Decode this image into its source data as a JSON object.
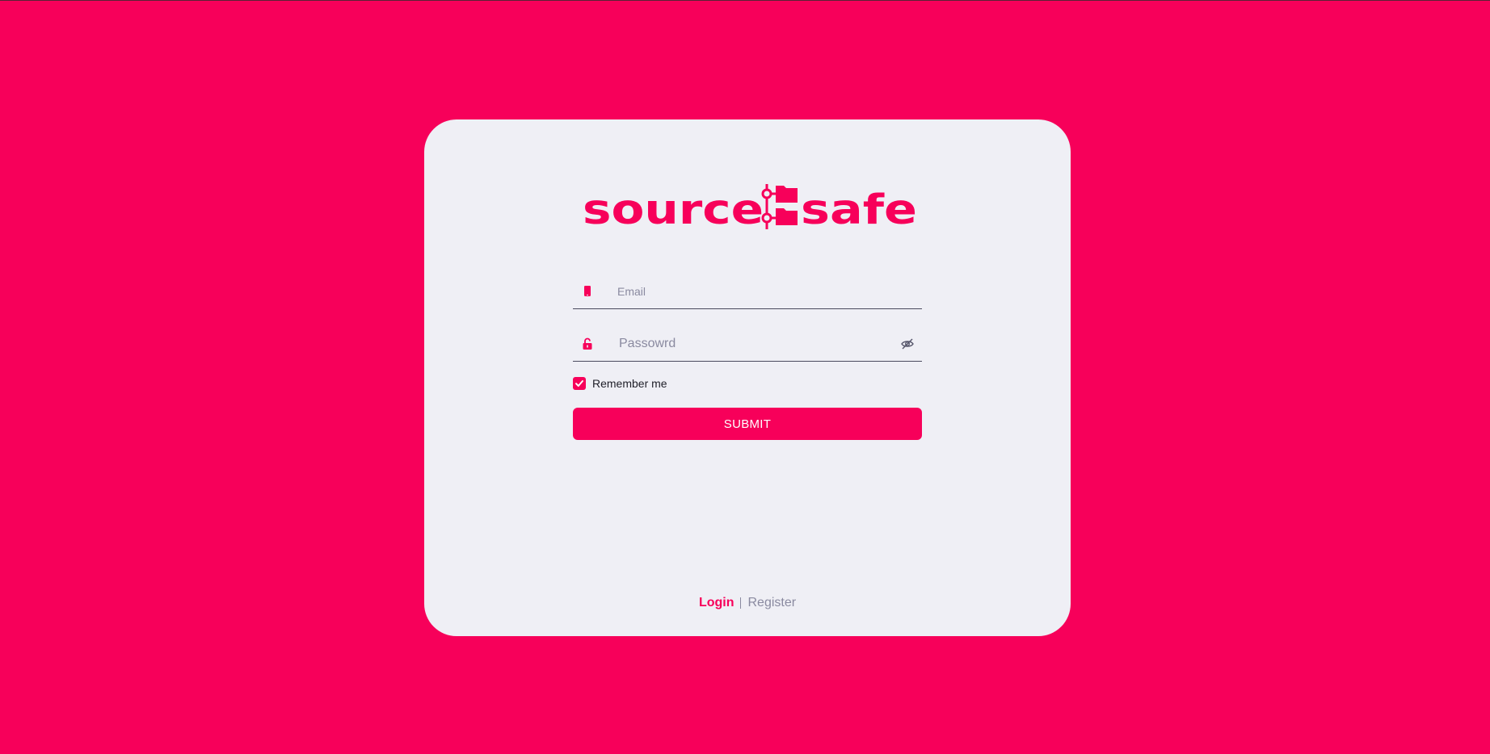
{
  "theme": {
    "accent": "#f7005a",
    "card_background": "#efeff5",
    "muted_text": "#8a8aa0"
  },
  "logo": {
    "text_left": "source",
    "text_right": "safe",
    "icon": "folder-tree-icon"
  },
  "form": {
    "email": {
      "placeholder": "Email",
      "value": "",
      "icon": "phone-icon"
    },
    "password": {
      "placeholder": "Passowrd",
      "value": "",
      "icon": "unlock-icon",
      "toggle_icon": "eye-off-icon"
    },
    "remember": {
      "label": "Remember me",
      "checked": true
    },
    "submit_label": "SUBMIT"
  },
  "footer": {
    "login_label": "Login",
    "register_label": "Register",
    "active": "Login"
  }
}
